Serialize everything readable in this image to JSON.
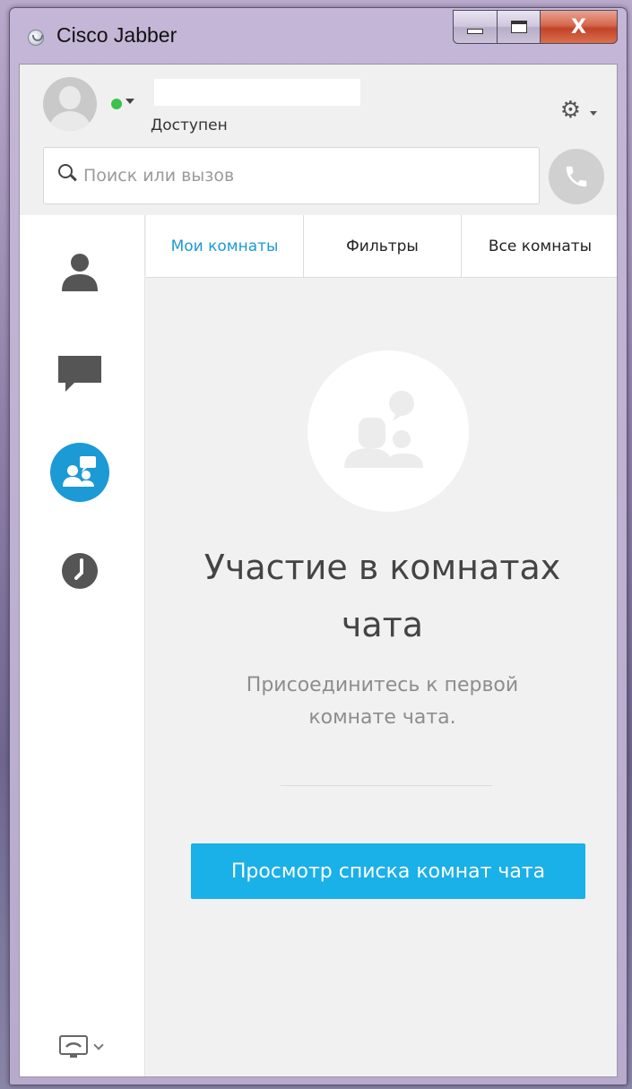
{
  "window": {
    "title": "Cisco Jabber",
    "close_glyph": "X"
  },
  "header": {
    "status_text": "Доступен",
    "status_color": "#3cc24a",
    "search_placeholder": "Поиск или вызов",
    "settings_icon": "gear-icon",
    "call_icon": "phone-icon"
  },
  "sidebar": {
    "items": [
      {
        "name": "contacts",
        "icon": "person-icon"
      },
      {
        "name": "chats",
        "icon": "chat-bubble-icon"
      },
      {
        "name": "chat-rooms",
        "icon": "chat-rooms-icon",
        "active": true
      },
      {
        "name": "recents",
        "icon": "clock-icon"
      }
    ],
    "footer_icon": "phone-control-icon"
  },
  "tabs": [
    {
      "label": "Мои комнаты",
      "active": true
    },
    {
      "label": "Фильтры",
      "active": false
    },
    {
      "label": "Все комнаты",
      "active": false
    }
  ],
  "empty_state": {
    "title": "Участие в комнатах чата",
    "subtitle": "Присоединитесь к первой комнате чата.",
    "button_label": "Просмотр списка комнат чата"
  },
  "colors": {
    "accent": "#1c9ad6",
    "button": "#1ab0e8"
  }
}
